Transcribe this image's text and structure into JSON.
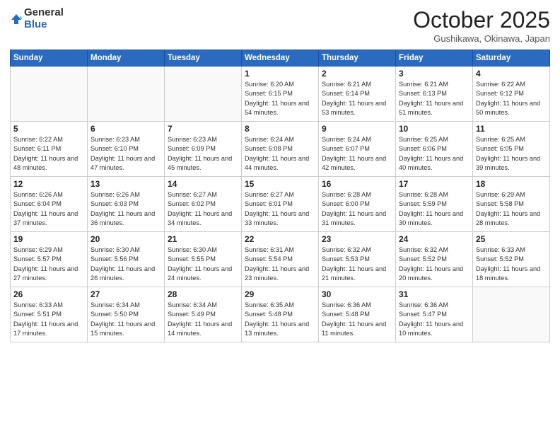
{
  "header": {
    "logo_general": "General",
    "logo_blue": "Blue",
    "month_title": "October 2025",
    "subtitle": "Gushikawa, Okinawa, Japan"
  },
  "days_of_week": [
    "Sunday",
    "Monday",
    "Tuesday",
    "Wednesday",
    "Thursday",
    "Friday",
    "Saturday"
  ],
  "weeks": [
    [
      {
        "day": "",
        "sunrise": "",
        "sunset": "",
        "daylight": ""
      },
      {
        "day": "",
        "sunrise": "",
        "sunset": "",
        "daylight": ""
      },
      {
        "day": "",
        "sunrise": "",
        "sunset": "",
        "daylight": ""
      },
      {
        "day": "1",
        "sunrise": "Sunrise: 6:20 AM",
        "sunset": "Sunset: 6:15 PM",
        "daylight": "Daylight: 11 hours and 54 minutes."
      },
      {
        "day": "2",
        "sunrise": "Sunrise: 6:21 AM",
        "sunset": "Sunset: 6:14 PM",
        "daylight": "Daylight: 11 hours and 53 minutes."
      },
      {
        "day": "3",
        "sunrise": "Sunrise: 6:21 AM",
        "sunset": "Sunset: 6:13 PM",
        "daylight": "Daylight: 11 hours and 51 minutes."
      },
      {
        "day": "4",
        "sunrise": "Sunrise: 6:22 AM",
        "sunset": "Sunset: 6:12 PM",
        "daylight": "Daylight: 11 hours and 50 minutes."
      }
    ],
    [
      {
        "day": "5",
        "sunrise": "Sunrise: 6:22 AM",
        "sunset": "Sunset: 6:11 PM",
        "daylight": "Daylight: 11 hours and 48 minutes."
      },
      {
        "day": "6",
        "sunrise": "Sunrise: 6:23 AM",
        "sunset": "Sunset: 6:10 PM",
        "daylight": "Daylight: 11 hours and 47 minutes."
      },
      {
        "day": "7",
        "sunrise": "Sunrise: 6:23 AM",
        "sunset": "Sunset: 6:09 PM",
        "daylight": "Daylight: 11 hours and 45 minutes."
      },
      {
        "day": "8",
        "sunrise": "Sunrise: 6:24 AM",
        "sunset": "Sunset: 6:08 PM",
        "daylight": "Daylight: 11 hours and 44 minutes."
      },
      {
        "day": "9",
        "sunrise": "Sunrise: 6:24 AM",
        "sunset": "Sunset: 6:07 PM",
        "daylight": "Daylight: 11 hours and 42 minutes."
      },
      {
        "day": "10",
        "sunrise": "Sunrise: 6:25 AM",
        "sunset": "Sunset: 6:06 PM",
        "daylight": "Daylight: 11 hours and 40 minutes."
      },
      {
        "day": "11",
        "sunrise": "Sunrise: 6:25 AM",
        "sunset": "Sunset: 6:05 PM",
        "daylight": "Daylight: 11 hours and 39 minutes."
      }
    ],
    [
      {
        "day": "12",
        "sunrise": "Sunrise: 6:26 AM",
        "sunset": "Sunset: 6:04 PM",
        "daylight": "Daylight: 11 hours and 37 minutes."
      },
      {
        "day": "13",
        "sunrise": "Sunrise: 6:26 AM",
        "sunset": "Sunset: 6:03 PM",
        "daylight": "Daylight: 11 hours and 36 minutes."
      },
      {
        "day": "14",
        "sunrise": "Sunrise: 6:27 AM",
        "sunset": "Sunset: 6:02 PM",
        "daylight": "Daylight: 11 hours and 34 minutes."
      },
      {
        "day": "15",
        "sunrise": "Sunrise: 6:27 AM",
        "sunset": "Sunset: 6:01 PM",
        "daylight": "Daylight: 11 hours and 33 minutes."
      },
      {
        "day": "16",
        "sunrise": "Sunrise: 6:28 AM",
        "sunset": "Sunset: 6:00 PM",
        "daylight": "Daylight: 11 hours and 31 minutes."
      },
      {
        "day": "17",
        "sunrise": "Sunrise: 6:28 AM",
        "sunset": "Sunset: 5:59 PM",
        "daylight": "Daylight: 11 hours and 30 minutes."
      },
      {
        "day": "18",
        "sunrise": "Sunrise: 6:29 AM",
        "sunset": "Sunset: 5:58 PM",
        "daylight": "Daylight: 11 hours and 28 minutes."
      }
    ],
    [
      {
        "day": "19",
        "sunrise": "Sunrise: 6:29 AM",
        "sunset": "Sunset: 5:57 PM",
        "daylight": "Daylight: 11 hours and 27 minutes."
      },
      {
        "day": "20",
        "sunrise": "Sunrise: 6:30 AM",
        "sunset": "Sunset: 5:56 PM",
        "daylight": "Daylight: 11 hours and 26 minutes."
      },
      {
        "day": "21",
        "sunrise": "Sunrise: 6:30 AM",
        "sunset": "Sunset: 5:55 PM",
        "daylight": "Daylight: 11 hours and 24 minutes."
      },
      {
        "day": "22",
        "sunrise": "Sunrise: 6:31 AM",
        "sunset": "Sunset: 5:54 PM",
        "daylight": "Daylight: 11 hours and 23 minutes."
      },
      {
        "day": "23",
        "sunrise": "Sunrise: 6:32 AM",
        "sunset": "Sunset: 5:53 PM",
        "daylight": "Daylight: 11 hours and 21 minutes."
      },
      {
        "day": "24",
        "sunrise": "Sunrise: 6:32 AM",
        "sunset": "Sunset: 5:52 PM",
        "daylight": "Daylight: 11 hours and 20 minutes."
      },
      {
        "day": "25",
        "sunrise": "Sunrise: 6:33 AM",
        "sunset": "Sunset: 5:52 PM",
        "daylight": "Daylight: 11 hours and 18 minutes."
      }
    ],
    [
      {
        "day": "26",
        "sunrise": "Sunrise: 6:33 AM",
        "sunset": "Sunset: 5:51 PM",
        "daylight": "Daylight: 11 hours and 17 minutes."
      },
      {
        "day": "27",
        "sunrise": "Sunrise: 6:34 AM",
        "sunset": "Sunset: 5:50 PM",
        "daylight": "Daylight: 11 hours and 15 minutes."
      },
      {
        "day": "28",
        "sunrise": "Sunrise: 6:34 AM",
        "sunset": "Sunset: 5:49 PM",
        "daylight": "Daylight: 11 hours and 14 minutes."
      },
      {
        "day": "29",
        "sunrise": "Sunrise: 6:35 AM",
        "sunset": "Sunset: 5:48 PM",
        "daylight": "Daylight: 11 hours and 13 minutes."
      },
      {
        "day": "30",
        "sunrise": "Sunrise: 6:36 AM",
        "sunset": "Sunset: 5:48 PM",
        "daylight": "Daylight: 11 hours and 11 minutes."
      },
      {
        "day": "31",
        "sunrise": "Sunrise: 6:36 AM",
        "sunset": "Sunset: 5:47 PM",
        "daylight": "Daylight: 11 hours and 10 minutes."
      },
      {
        "day": "",
        "sunrise": "",
        "sunset": "",
        "daylight": ""
      }
    ]
  ]
}
